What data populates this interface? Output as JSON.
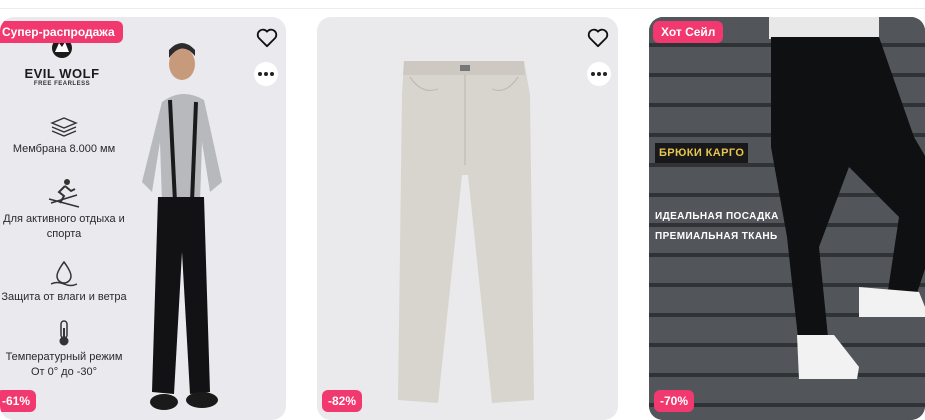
{
  "cards": [
    {
      "badge": "Супер-распродажа",
      "discount": "-61%",
      "brand": {
        "name": "EVIL WOLF",
        "tagline": "FREE FEARLESS"
      },
      "features": [
        {
          "icon": "membrane-icon",
          "text": "Мембрана 8.000 мм"
        },
        {
          "icon": "skier-icon",
          "text": "Для активного отдыха и спорта"
        },
        {
          "icon": "water-drop-icon",
          "text": "Защита от влаги и ветра"
        },
        {
          "icon": "thermometer-icon",
          "text": "Температурный режим От 0° до -30°"
        }
      ]
    },
    {
      "badge": "",
      "discount": "-82%"
    },
    {
      "badge": "Хот Сейл",
      "discount": "-70%",
      "overlay": {
        "title": "БРЮКИ КАРГО",
        "line1": "ИДЕАЛЬНАЯ ПОСАДКА",
        "line2": "ПРЕМИАЛЬНАЯ ТКАНЬ"
      }
    }
  ],
  "icons": {
    "favorite": "heart-icon",
    "more": "more-dots-icon"
  },
  "colors": {
    "badge": "#f1386f",
    "overlay_accent": "#e7c44d"
  }
}
